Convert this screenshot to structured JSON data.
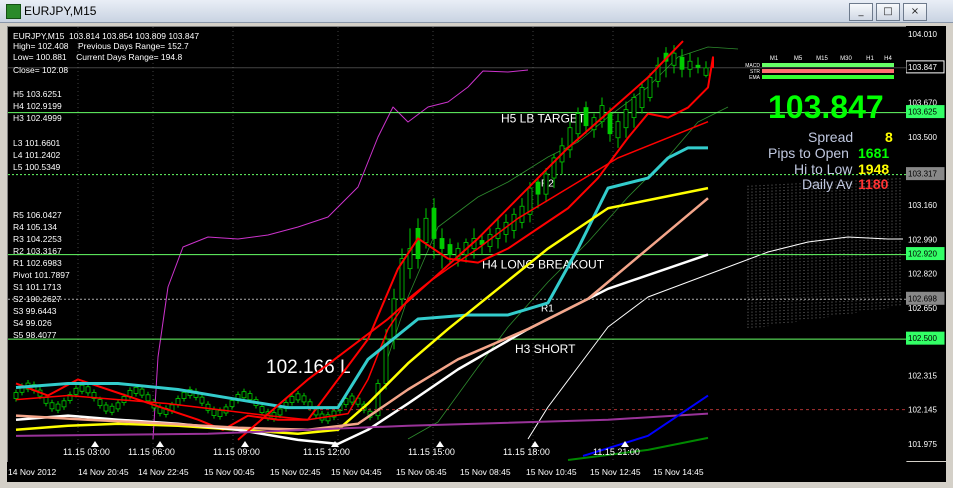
{
  "window": {
    "title": "EURJPY,M15",
    "btn_min": "_",
    "btn_max": "□",
    "btn_close": "×"
  },
  "header": {
    "line1": "EURJPY,M15  103.814 103.854 103.809 103.847",
    "line2": "High= 102.408    Previous Days Range= 152.7",
    "line3": "Low= 100.881    Current Days Range= 194.8",
    "line4": "Close= 102.08"
  },
  "levels_left": {
    "h5": "H5 103.6251",
    "h4": "H4 102.9199",
    "h3": "H3 102.4999",
    "l3": "L3 101.6601",
    "l4": "L4 101.2402",
    "l5": "L5 100.5349",
    "r5": "R5 106.0427",
    "r4": "R4 105.134",
    "r3": "R3 104.2253",
    "r2": "R2 103.3167",
    "r1": "R1 102.6983",
    "pivot": "Pivot 101.7897",
    "s1": "S1 101.1713",
    "s2": "S2 100.2627",
    "s3": "S3 99.6443",
    "s4": "S4 99.026",
    "s5": "S5 98.4077"
  },
  "annotations": {
    "h5_target": "H5 LB TARGET",
    "h4_breakout": "H4 LONG BREAKOUT",
    "h3_short": "H3 SHORT",
    "r2": "R2",
    "r1": "R1",
    "entry": "102.166 L"
  },
  "panel": {
    "price": "103.847",
    "spread_label": "Spread",
    "spread_value": "8",
    "pips_label": "Pips to Open",
    "pips_value": "1681",
    "hilo_label": "Hi to Low",
    "hilo_value": "1948",
    "dailyav_label": "Daily Av",
    "dailyav_value": "1180",
    "tf_labels": [
      "M1",
      "M5",
      "M15",
      "M30",
      "H1",
      "H4"
    ],
    "row_labels": [
      "MACD",
      "STR",
      "EMA"
    ]
  },
  "colors": {
    "background": "#000000",
    "candle": "#00cc00",
    "red": "#ff0000",
    "yellow": "#ffff00",
    "cyan": "#33cccc",
    "salmon": "#f4a58a",
    "white": "#ffffff",
    "magenta": "#cc33cc",
    "purple": "#993399",
    "blue": "#0000ff",
    "green_level": "#66ff66"
  },
  "chart_data": {
    "type": "line",
    "title": "EURJPY,M15",
    "ylim": [
      101.89,
      104.05
    ],
    "y_ticks": [
      "104.010",
      "103.847",
      "103.670",
      "103.625",
      "103.500",
      "103.317",
      "103.160",
      "102.990",
      "102.920",
      "102.820",
      "102.698",
      "102.650",
      "102.500",
      "102.315",
      "102.145",
      "101.975"
    ],
    "x_ticks": [
      "14 Nov 2012",
      "14 Nov 20:45",
      "14 Nov 22:45",
      "15 Nov 00:45",
      "15 Nov 02:45",
      "15 Nov 04:45",
      "15 Nov 06:45",
      "15 Nov 08:45",
      "15 Nov 10:45",
      "15 Nov 12:45",
      "15 Nov 14:45"
    ],
    "session_labels": [
      "11.15 03:00",
      "11.15 06:00",
      "11.15 09:00",
      "11.15 12:00",
      "11.15 15:00",
      "11.15 18:00",
      "11.15 21:00"
    ],
    "horizontal_levels": [
      {
        "name": "H5",
        "value": 103.625
      },
      {
        "name": "R2",
        "value": 103.317
      },
      {
        "name": "H4",
        "value": 102.92
      },
      {
        "name": "R1",
        "value": 102.698
      },
      {
        "name": "H3",
        "value": 102.5
      },
      {
        "name": "Close",
        "value": 103.847
      }
    ],
    "series": [
      {
        "values": [
          102.28,
          102.22,
          102.3,
          102.25,
          102.2,
          102.15,
          102.1,
          102.05,
          102.12,
          102.1,
          102.1,
          102.3,
          102.5,
          102.85,
          103.0,
          102.9,
          102.88,
          102.95,
          103.05,
          103.15,
          103.3,
          103.5,
          103.62,
          103.6,
          103.65,
          103.75,
          103.9,
          103.847
        ]
      },
      {
        "values": [
          102.2,
          102.22,
          102.2,
          102.18,
          102.15,
          102.12,
          102.1,
          102.13,
          102.3,
          102.55,
          102.7,
          102.78,
          102.85,
          102.95,
          103.1,
          103.25,
          103.4,
          103.5,
          103.58
        ]
      },
      {
        "values": [
          102.26,
          102.28,
          102.28,
          102.25,
          102.2,
          102.16,
          102.16,
          102.4,
          102.6,
          102.62,
          102.62,
          102.68,
          102.95,
          103.25,
          103.3,
          103.4,
          103.45,
          103.45
        ]
      },
      {
        "values": [
          102.05,
          102.07,
          102.08,
          102.07,
          102.05,
          102.03,
          102.05,
          102.18,
          102.38,
          102.55,
          102.75,
          102.95,
          103.15,
          103.25
        ]
      },
      {
        "values": [
          102.1,
          102.12,
          102.1,
          102.08,
          102.05,
          102.0,
          101.98,
          102.05,
          102.18,
          102.35,
          102.55,
          102.75,
          102.92
        ]
      }
    ]
  }
}
